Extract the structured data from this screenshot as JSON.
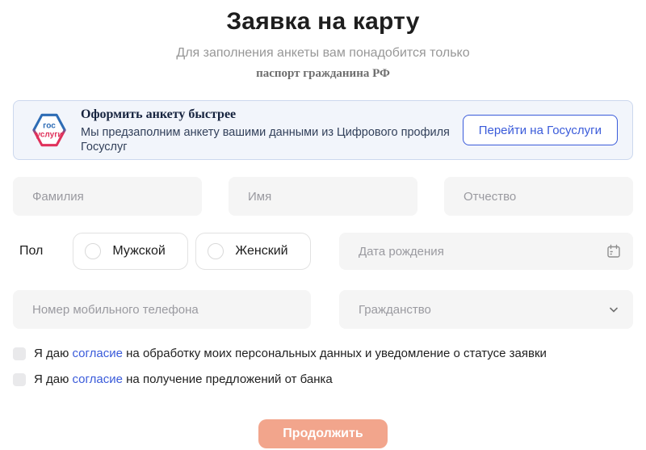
{
  "page": {
    "title": "Заявка на карту",
    "subtitle_line1": "Для заполнения анкеты вам понадобится только",
    "subtitle_line2": "паспорт гражданина РФ"
  },
  "gosuslugi_banner": {
    "logo_line1": "гос",
    "logo_line2": "услуги",
    "heading": "Оформить анкету быстрее",
    "description": "Мы предзаполним анкету вашими данными из Цифрового профиля Госуслуг",
    "button_label": "Перейти на Госуслуги"
  },
  "form": {
    "last_name": {
      "value": "",
      "placeholder": "Фамилия"
    },
    "first_name": {
      "value": "",
      "placeholder": "Имя"
    },
    "middle_name": {
      "value": "",
      "placeholder": "Отчество"
    },
    "gender_label": "Пол",
    "gender_options": [
      {
        "label": "Мужской",
        "selected": false
      },
      {
        "label": "Женский",
        "selected": false
      }
    ],
    "birth_date": {
      "value": "",
      "placeholder": "Дата рождения"
    },
    "phone": {
      "value": "",
      "placeholder": "Номер мобильного телефона"
    },
    "citizenship": {
      "value": "",
      "placeholder": "Гражданство"
    }
  },
  "consents": [
    {
      "prefix": "Я даю ",
      "link": "согласие",
      "suffix": " на обработку моих персональных данных и уведомление о статусе заявки",
      "checked": false
    },
    {
      "prefix": "Я даю ",
      "link": "согласие",
      "suffix": " на получение предложений от банка",
      "checked": false
    }
  ],
  "submit": {
    "label": "Продолжить"
  },
  "icons": [
    "gosuslugi-logo",
    "calendar-icon",
    "chevron-down-icon"
  ],
  "colors": {
    "accent_blue": "#3a5bda",
    "submit_salmon": "#f2a58c",
    "banner_bg": "#f2f5fb",
    "banner_border": "#ccd8ee",
    "field_bg": "#f5f5f5",
    "logo_blue": "#2d6cb5",
    "logo_red": "#e0315b",
    "placeholder_gray": "#9a9aa0"
  }
}
